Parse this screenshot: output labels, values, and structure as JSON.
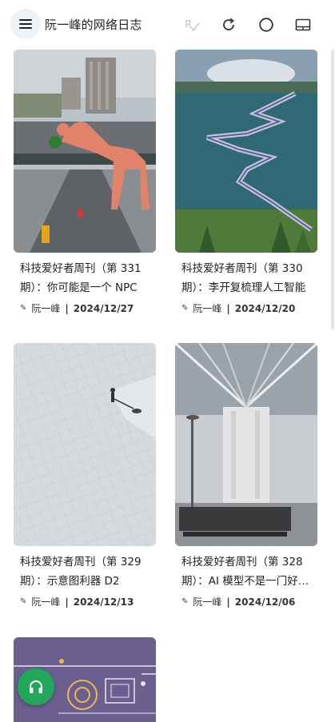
{
  "header": {
    "site_title": "阮一峰的网络日志",
    "icons": [
      "menu-icon",
      "spell-check-icon",
      "refresh-icon",
      "circle-icon",
      "reader-mode-icon"
    ]
  },
  "posts": [
    {
      "title": "科技爱好者周刊（第 331 期）：你可能是一个 NPC",
      "author": "阮一峰",
      "date": "2024/12/27",
      "image": "city-giraffe-bridge"
    },
    {
      "title": "科技爱好者周刊（第 330 期）：李开复梳理人工智能",
      "author": "阮一峰",
      "date": "2024/12/20",
      "image": "winding-lake-walkway"
    },
    {
      "title": "科技爱好者周刊（第 329 期）：示意图利器 D2",
      "author": "阮一峰",
      "date": "2024/12/13",
      "image": "snow-plaza-worker"
    },
    {
      "title": "科技爱好者周刊（第 328 期）：AI 模型不是一门好…",
      "author": "阮一峰",
      "date": "2024/12/06",
      "image": "station-waiting-hall"
    },
    {
      "title": "",
      "author": "",
      "date": "",
      "image": "purple-circuit-illustration"
    }
  ],
  "fab": {
    "icon": "headphones-icon"
  },
  "colors": {
    "fab": "#22a85a",
    "menu_bg": "#eef1f6",
    "purple_card": "#6a5f8f"
  }
}
